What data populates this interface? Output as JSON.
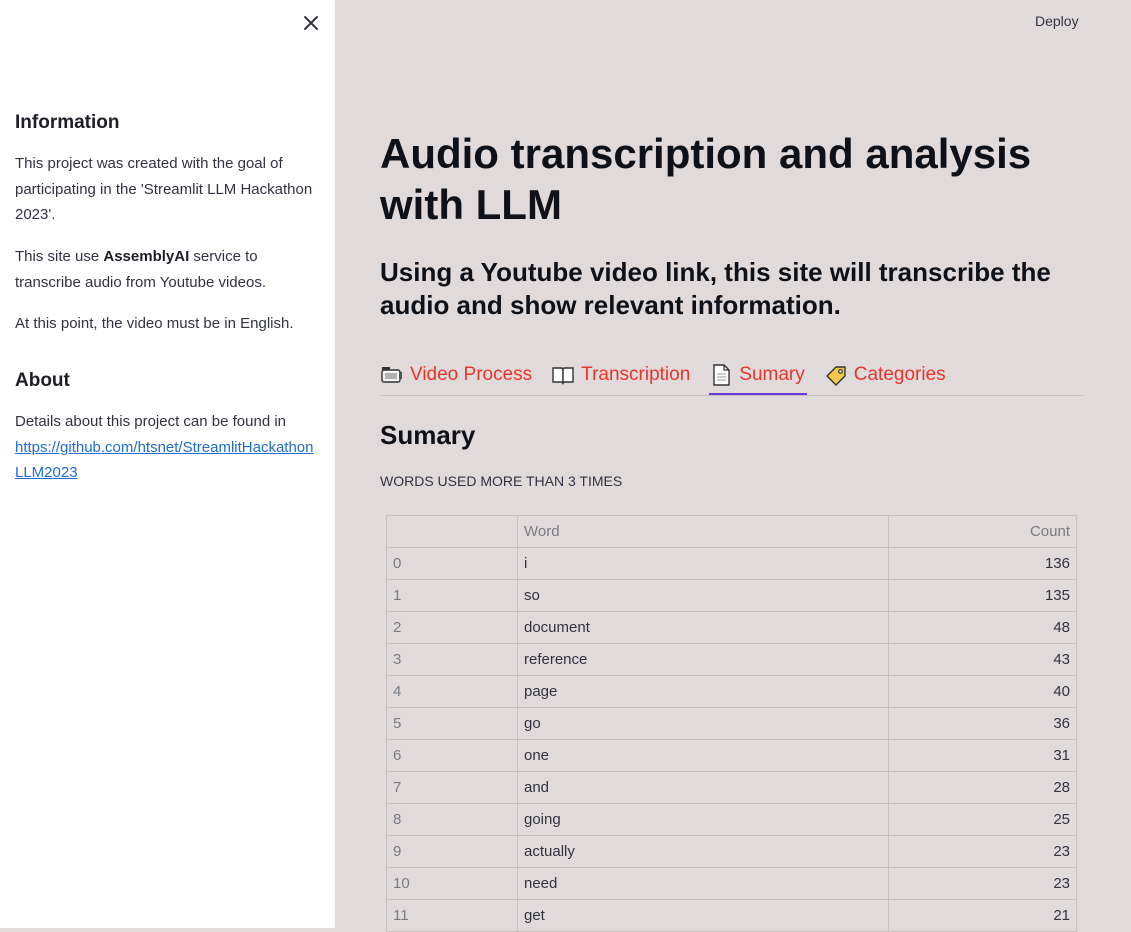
{
  "sidebar": {
    "close_icon": "close-icon",
    "information": {
      "heading": "Information",
      "p1": "This project was created with the goal of participating in the 'Streamlit LLM Hackathon 2023'.",
      "p2_prefix": "This site use ",
      "p2_bold": "AssemblyAI",
      "p2_suffix": " service to transcribe audio from Youtube videos.",
      "p3": "At this point, the video must be in English."
    },
    "about": {
      "heading": "About",
      "text": "Details about this project can be found in",
      "link": "https://github.com/htsnet/StreamlitHackathonLLM2023"
    }
  },
  "header": {
    "deploy_label": "Deploy"
  },
  "main": {
    "title": "Audio transcription and analysis with LLM",
    "subtitle": "Using a Youtube video link, this site will transcribe the audio and show relevant information.",
    "tabs": [
      {
        "label": "Video Process",
        "icon": "video-camera-icon",
        "active": false
      },
      {
        "label": "Transcription",
        "icon": "open-book-icon",
        "active": false
      },
      {
        "label": "Sumary",
        "icon": "document-icon",
        "active": true
      },
      {
        "label": "Categories",
        "icon": "tag-icon",
        "active": false
      }
    ],
    "section_title": "Sumary",
    "caption": "WORDS USED MORE THAN 3 TIMES",
    "table": {
      "headers": [
        "",
        "Word",
        "Count"
      ],
      "rows": [
        [
          "0",
          "i",
          "136"
        ],
        [
          "1",
          "so",
          "135"
        ],
        [
          "2",
          "document",
          "48"
        ],
        [
          "3",
          "reference",
          "43"
        ],
        [
          "4",
          "page",
          "40"
        ],
        [
          "5",
          "go",
          "36"
        ],
        [
          "6",
          "one",
          "31"
        ],
        [
          "7",
          "and",
          "28"
        ],
        [
          "8",
          "going",
          "25"
        ],
        [
          "9",
          "actually",
          "23"
        ],
        [
          "10",
          "need",
          "23"
        ],
        [
          "11",
          "get",
          "21"
        ]
      ]
    }
  },
  "colors": {
    "accent_tab_text": "#e8352a",
    "active_tab_underline": "#6a3ad8",
    "link": "#1f6bd1",
    "main_background": "#e0dadb"
  }
}
